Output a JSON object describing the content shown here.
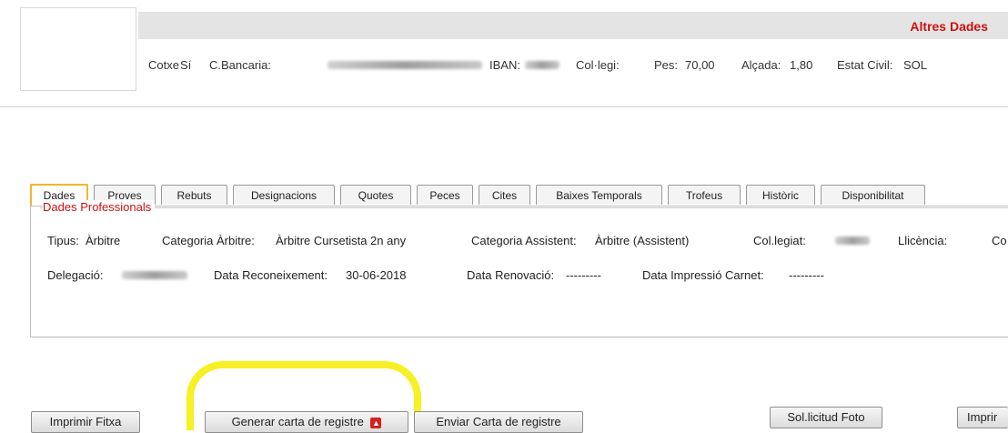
{
  "header": {
    "altres_dades": "Altres Dades"
  },
  "info": {
    "cotxe_label": "Cotxe",
    "cotxe_value": "Sí",
    "bancaria_label": "C.Bancaria:",
    "iban_label": "IBAN:",
    "collegi_label": "Col·legi:",
    "pes_label": "Pes:",
    "pes_value": "70,00",
    "alcada_label": "Alçada:",
    "alcada_value": "1,80",
    "estat_label": "Estat Civil:",
    "estat_value": "SOL"
  },
  "tabs": [
    "Dades",
    "Proves",
    "Rebuts",
    "Designacions",
    "Quotes",
    "Peces",
    "Cites",
    "Baixes Temporals",
    "Trofeus",
    "Històric",
    "Disponibilitat"
  ],
  "section": {
    "legend": "Dades Professionals",
    "tipus_label": "Tipus:",
    "tipus_value": "Àrbitre",
    "categoria_label": "Categoria Àrbitre:",
    "categoria_value": "Àrbitre Cursetista 2n any",
    "assistent_label": "Categoria Assistent:",
    "assistent_value": "Àrbitre (Assistent)",
    "colegiat_label": "Col.legiat:",
    "llicencia_label": "Llicència:",
    "extra_cut": "Co",
    "delegacio_label": "Delegació:",
    "reconeixement_label": "Data Reconeixement:",
    "reconeixement_value": "30-06-2018",
    "renovacio_label": "Data Renovació:",
    "renovacio_value": "---------",
    "impressio_label": "Data Impressió Carnet:",
    "impressio_value": "---------"
  },
  "buttons": {
    "imprimir_fitxa": "Imprimir Fitxa",
    "generar_carta": "Generar carta de registre",
    "enviar_carta": "Enviar Carta de registre",
    "sollicitud_foto": "Sol.licitud Foto",
    "imprimir_cut": "Imprir"
  },
  "colors": {
    "accent_red": "#cc1111",
    "highlight_yellow": "#f6f01a",
    "active_tab_border": "#f1b530"
  },
  "icons": {
    "pdf": "pdf-icon"
  }
}
